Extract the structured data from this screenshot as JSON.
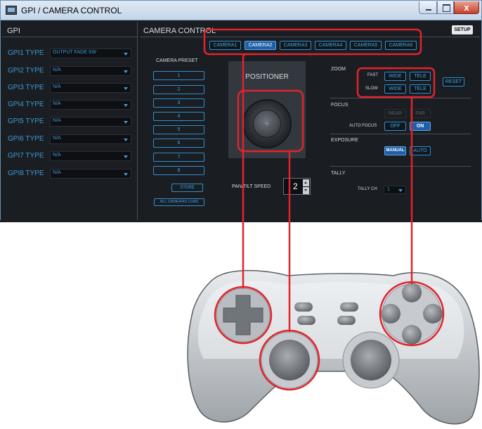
{
  "window": {
    "title": "GPI / CAMERA CONTROL",
    "close_glyph": "x"
  },
  "gpi": {
    "title": "GPI",
    "rows": [
      {
        "label": "GPI1 TYPE",
        "value": "OUTPUT FADE SW"
      },
      {
        "label": "GPI2 TYPE",
        "value": "N/A"
      },
      {
        "label": "GPI3 TYPE",
        "value": "N/A"
      },
      {
        "label": "GPI4 TYPE",
        "value": "N/A"
      },
      {
        "label": "GPI5 TYPE",
        "value": "N/A"
      },
      {
        "label": "GPI6 TYPE",
        "value": "N/A"
      },
      {
        "label": "GPI7 TYPE",
        "value": "N/A"
      },
      {
        "label": "GPI8 TYPE",
        "value": "N/A"
      }
    ]
  },
  "camera_control": {
    "title": "CAMERA CONTROL",
    "setup_label": "SETUP",
    "cameras": [
      "CAMERA1",
      "CAMERA2",
      "CAMERA3",
      "CAMERA4",
      "CAMERA5",
      "CAMERA6"
    ],
    "active_camera": "CAMERA2",
    "preset": {
      "title": "CAMERA PRESET",
      "buttons": [
        "1",
        "2",
        "3",
        "4",
        "5",
        "6",
        "7",
        "8"
      ],
      "store_label": "STORE",
      "load_all_label": "ALL CAMERAS LOAD"
    },
    "positioner": {
      "label": "POSITIONER"
    },
    "pan_tilt": {
      "label": "PAN/TILT SPEED",
      "value": "2"
    },
    "zoom": {
      "title": "ZOOM",
      "fast_label": "FAST",
      "slow_label": "SLOW",
      "wide_label": "WIDE",
      "tele_label": "TELE",
      "reset_label": "RESET"
    },
    "focus": {
      "title": "FOCUS",
      "near_label": "NEAR",
      "far_label": "FAR",
      "auto_label": "AUTO FOCUS",
      "off_label": "OFF",
      "on_label": "ON"
    },
    "exposure": {
      "title": "EXPOSURE",
      "manual_label": "MANUAL",
      "auto_label": "AUTO"
    },
    "tally": {
      "title": "TALLY",
      "ch_label": "TALLY CH",
      "ch_value": "1"
    }
  },
  "colors": {
    "accent": "#3ea6e6",
    "active": "#1f5fa8",
    "panel_bg": "#1a1d22",
    "highlight_red": "#e0242c"
  }
}
